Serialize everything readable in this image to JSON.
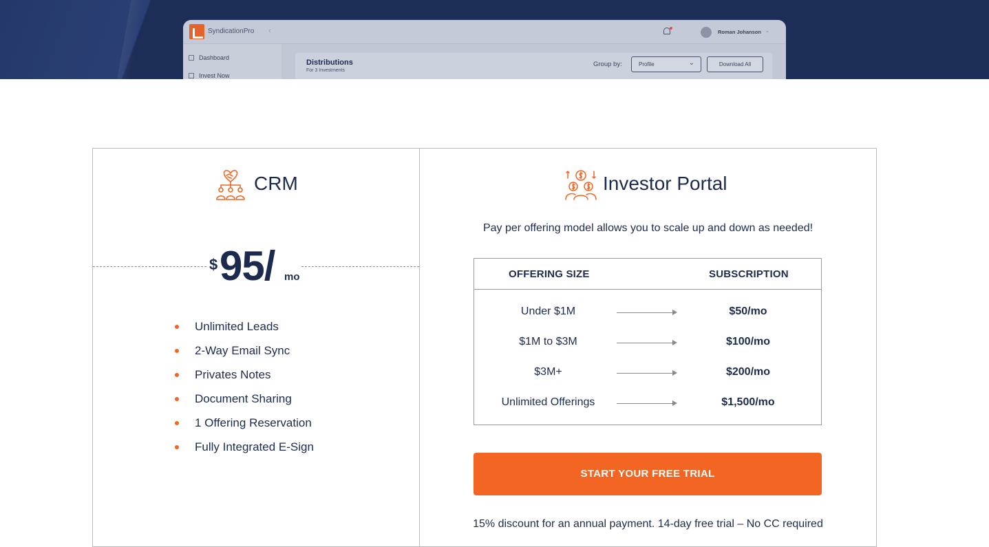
{
  "app_preview": {
    "brand": "SyndicationPro",
    "user_name": "Roman Johanson",
    "sidebar": [
      {
        "label": "Dashboard",
        "icon": "home-icon"
      },
      {
        "label": "Invest Now",
        "icon": "document-icon"
      }
    ],
    "distributions_title": "Distributions",
    "distributions_subtitle": "For 3 Investments",
    "group_by_label": "Group by:",
    "group_by_value": "Profile",
    "download_label": "Download All"
  },
  "crm": {
    "title": "CRM",
    "icon": "handshake-team-icon",
    "price_currency": "$",
    "price_amount": "95/",
    "price_period": "mo",
    "features": [
      "Unlimited Leads",
      "2-Way Email Sync",
      "Privates Notes",
      "Document Sharing",
      "1 Offering Reservation",
      "Fully Integrated E-Sign"
    ]
  },
  "investor_portal": {
    "title": "Investor Portal",
    "icon": "investors-money-icon",
    "tagline": "Pay per offering model allows you to scale up and down as needed!",
    "table_headers": {
      "size": "OFFERING SIZE",
      "subscription": "SUBSCRIPTION"
    },
    "rows": [
      {
        "size": "Under $1M",
        "price": "$50/mo"
      },
      {
        "size": "$1M to $3M",
        "price": "$100/mo"
      },
      {
        "size": "$3M+",
        "price": "$200/mo"
      },
      {
        "size": "Unlimited Offerings",
        "price": "$1,500/mo"
      }
    ],
    "cta_label": "START YOUR FREE TRIAL",
    "footnote": "15% discount for an annual payment. 14-day free trial – No CC required"
  },
  "colors": {
    "navy": "#1c2a4d",
    "accent": "#f26522",
    "hero_bg": "#1c2d58"
  }
}
